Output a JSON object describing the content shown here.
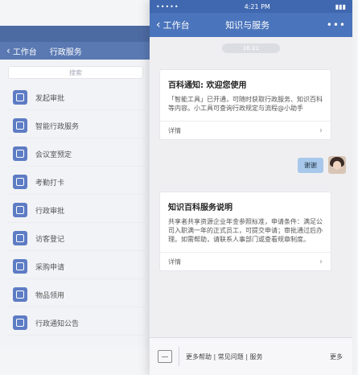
{
  "back_phone": {
    "nav": {
      "back_label": "工作台",
      "title": "行政服务"
    },
    "search_placeholder": "搜索",
    "items": [
      {
        "label": "发起审批"
      },
      {
        "label": "智能行政服务"
      },
      {
        "label": "会议室预定"
      },
      {
        "label": "考勤打卡"
      },
      {
        "label": "行政审批"
      },
      {
        "label": "访客登记"
      },
      {
        "label": "采购申请"
      },
      {
        "label": "物品领用"
      },
      {
        "label": "行政通知公告"
      }
    ]
  },
  "front_phone": {
    "status": {
      "time": "4:21 PM",
      "signal": "••••• ",
      "battery": "▮▮▮"
    },
    "nav": {
      "back_label": "工作台",
      "title": "知识与服务",
      "more": "•••"
    },
    "timestamp": "16:21",
    "card1": {
      "title": "百科通知: 欢迎您使用",
      "body": "「智能工具」已开通，可随时获取行政服务、知识百科等内容。小工具可查询行政规定与流程@小助手",
      "footer_label": "详情",
      "footer_arrow": "›"
    },
    "reply": {
      "text": "谢谢"
    },
    "card2": {
      "title": "知识百科服务说明",
      "body": "共享者共享资源企业年金参照标准，申请条件：满足公司入职满一年的正式员工，可提交申请；审批通过后办理。如需帮助，请联系人事部门或查看规章制度。",
      "footer_label": "详情",
      "footer_arrow": "›"
    },
    "bottom": {
      "menu": "更多帮助 | 常见问题 | 服务",
      "more": "更多"
    }
  },
  "colors": {
    "nav_blue": "#4a74bb",
    "icon_blue": "#5d7cc4",
    "bubble": "#a7c8ea"
  }
}
